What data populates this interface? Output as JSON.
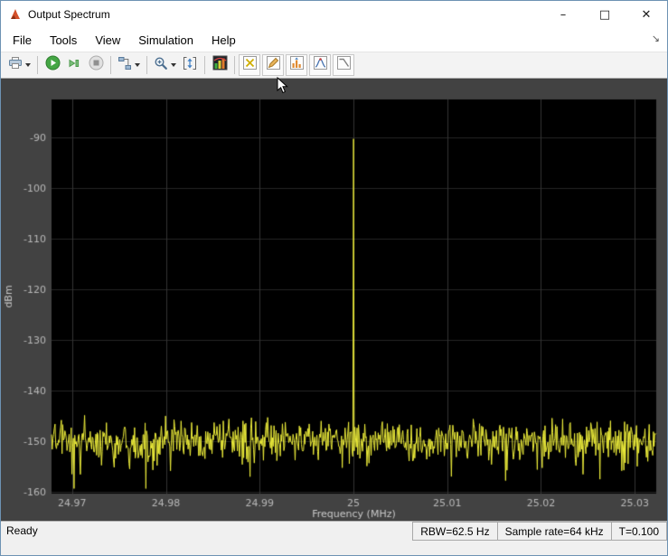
{
  "window": {
    "title": "Output Spectrum",
    "caption_buttons": {
      "minimize": "–",
      "maximize": "□",
      "close": "✕"
    },
    "dock_arrow": "↘"
  },
  "menu": {
    "items": [
      "File",
      "Tools",
      "View",
      "Simulation",
      "Help"
    ]
  },
  "toolbar": {
    "buttons": [
      {
        "name": "print-button",
        "icon": "printer-icon",
        "dropdown": true
      },
      {
        "name": "run-button",
        "icon": "play-icon"
      },
      {
        "name": "step-forward-button",
        "icon": "step-forward-icon"
      },
      {
        "name": "stop-button",
        "icon": "stop-icon",
        "disabled": true
      },
      {
        "name": "simulink-blocks-button",
        "icon": "blocks-icon",
        "dropdown": true
      },
      {
        "name": "zoom-button",
        "icon": "magnifier-icon",
        "dropdown": true
      },
      {
        "name": "fit-to-view-button",
        "icon": "fit-to-view-icon"
      },
      {
        "name": "spectrum-settings-button",
        "icon": "spectrum-colors-icon"
      },
      {
        "name": "cursor-measurements-button",
        "icon": "cursor-x-icon"
      },
      {
        "name": "signal-statistics-button",
        "icon": "pencil-ruler-icon"
      },
      {
        "name": "peak-finder-button",
        "icon": "peaks-icon"
      },
      {
        "name": "distortion-measurements-button",
        "icon": "distortion-curve-icon"
      },
      {
        "name": "ccdf-measurements-button",
        "icon": "diagonal-line-icon"
      }
    ]
  },
  "statusbar": {
    "ready": "Ready",
    "segments": [
      "RBW=62.5 Hz",
      "Sample rate=64 kHz",
      "T=0.100"
    ]
  },
  "chart_data": {
    "type": "line",
    "title": "",
    "xlabel": "Frequency (MHz)",
    "ylabel": "dBm",
    "xlim": [
      24.9678,
      25.0323
    ],
    "ylim": [
      -160.4,
      -82.5
    ],
    "x_ticks": [
      24.97,
      24.98,
      24.99,
      25,
      25.01,
      25.02,
      25.03
    ],
    "x_tick_labels": [
      "24.97",
      "24.98",
      "24.99",
      "25",
      "25.01",
      "25.02",
      "25.03"
    ],
    "y_ticks": [
      -90,
      -100,
      -110,
      -120,
      -130,
      -140,
      -150,
      -160
    ],
    "grid": true,
    "legend": "none",
    "background_color": "#000000",
    "panel_color": "#424242",
    "grid_color_vertical": "#353535",
    "grid_color_horizontal": "#262626",
    "tick_color": "#b9b9b9",
    "label_color": "#c8c8c8",
    "line_color": "#ecec3a",
    "series": [
      {
        "name": "output-spectrum",
        "description": "noise floor around -150 dBm with a single narrow tone at 25 MHz reaching -90 dBm",
        "noise_floor_dbm": -150,
        "noise_spread_db": 6.5,
        "dip_probability": 0.05,
        "dip_depth_db": 7,
        "points": 860,
        "seed": 1234,
        "peak": {
          "x": 25,
          "y": -90.3,
          "base_y": -140
        }
      }
    ]
  }
}
